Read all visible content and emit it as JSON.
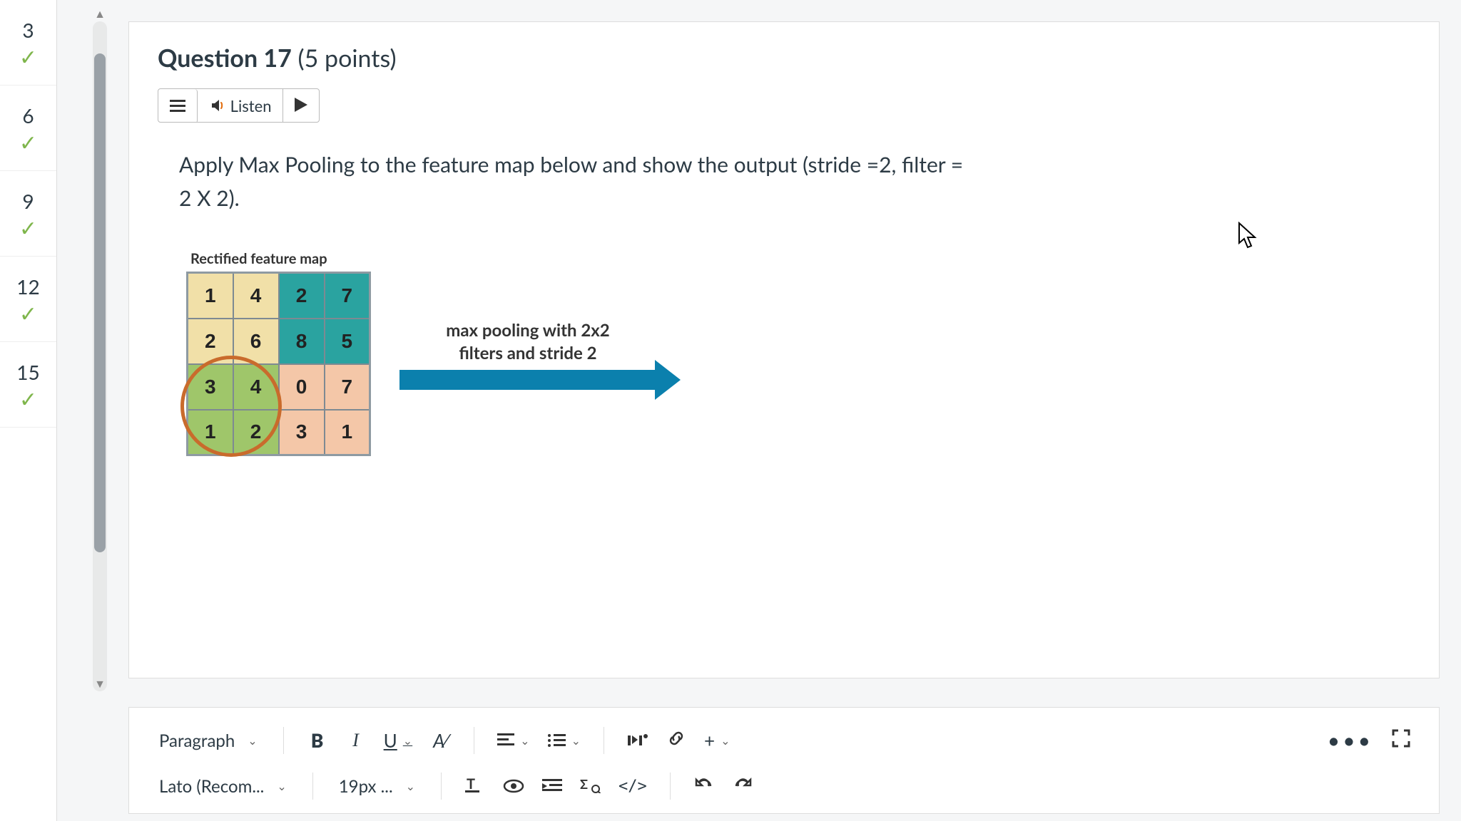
{
  "nav": {
    "items": [
      {
        "number": "3"
      },
      {
        "number": "6"
      },
      {
        "number": "9"
      },
      {
        "number": "12"
      },
      {
        "number": "15"
      }
    ]
  },
  "question": {
    "label_prefix": "Question ",
    "number": "17",
    "points_text": " (5 points)"
  },
  "listen": {
    "label": "Listen"
  },
  "prompt_line1": "Apply Max Pooling to the feature map below and show the output (stride =2, filter =",
  "prompt_line2": "2 X 2).",
  "feature_map": {
    "caption": "Rectified feature map",
    "rows": [
      [
        "1",
        "4",
        "2",
        "7"
      ],
      [
        "2",
        "6",
        "8",
        "5"
      ],
      [
        "3",
        "4",
        "0",
        "7"
      ],
      [
        "1",
        "2",
        "3",
        "1"
      ]
    ]
  },
  "arrow_label_line1": "max pooling with 2x2",
  "arrow_label_line2": "filters and stride 2",
  "toolbar": {
    "block_format": "Paragraph",
    "font_family": "Lato (Recom...",
    "font_size": "19px ...",
    "bold": "B",
    "italic": "I",
    "underline": "U",
    "clear_format": "A̶",
    "more": "•••",
    "insert_plus": "+"
  }
}
